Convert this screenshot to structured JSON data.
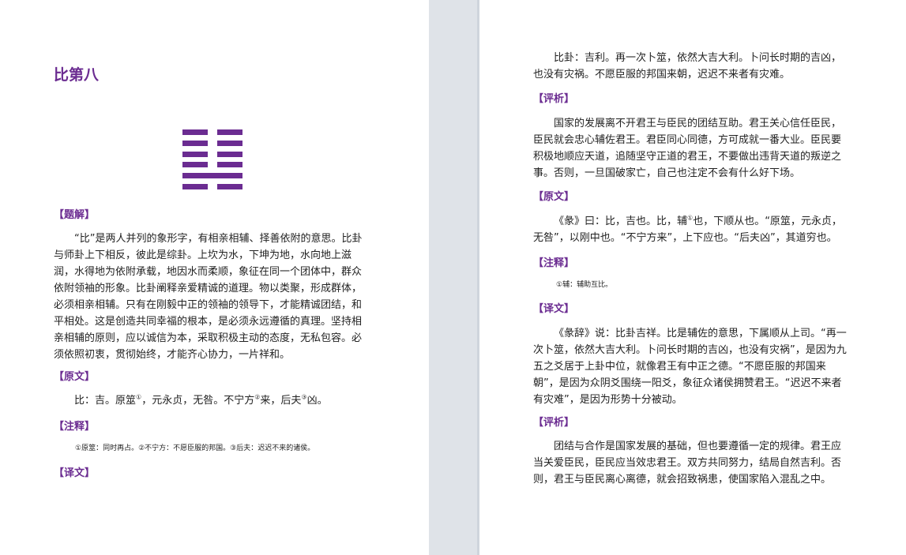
{
  "left_page": {
    "title": "比第八",
    "hexagram_lines": [
      "broken",
      "broken",
      "broken",
      "broken",
      "solid",
      "broken"
    ],
    "sections": {
      "tijie_heading": "【题解】",
      "tijie_lines": [
        "“比”是两人并列的象形字，有相亲相辅、择善依附的意思。比卦",
        "与师卦上下相反，彼此是综卦。上坎为水，下坤为地，水向地上滋",
        "润，水得地为依附承载，地因水而柔顺，象征在同一个团体中，群众",
        "依附领袖的形象。比卦阐释亲爱精诚的道理。物以类聚，形成群体，",
        "必须相亲相辅。只有在刚毅中正的领袖的领导下，才能精诚团结，和",
        "平相处。这是创造共同幸福的根本，是必须永远遵循的真理。坚持相",
        "亲相辅的原则，应以诚信为本，采取积极主动的态度，无私包容。必",
        "须依照初衷，贯彻始终，才能齐心协力，一片祥和。"
      ],
      "yuanwen_heading": "【原文】",
      "yuanwen_parts": [
        "比：吉。原筮",
        "①",
        "，元永贞，无咎。不宁方",
        "②",
        "来，后夫",
        "③",
        "凶。"
      ],
      "zhushi_heading": "【注释】",
      "zhushi_text": "①原筮：同时再占。②不宁方：不愿臣服的邦国。③后夫：迟迟不来的诸侯。",
      "yiwen_heading": "【译文】"
    }
  },
  "right_page": {
    "yiwen_lines": [
      "比卦：吉利。再一次卜筮，依然大吉大利。卜问长时期的吉凶，",
      "也没有灾祸。不愿臣服的邦国来朝，迟迟不来者有灾难。"
    ],
    "pingxi1_heading": "【评析】",
    "pingxi1_lines": [
      "国家的发展离不开君王与臣民的团结互助。君王关心信任臣民，",
      "臣民就会忠心辅佐君王。君臣同心同德，方可成就一番大业。臣民要",
      "积极地顺应天道，追随坚守正道的君王，不要做出违背天道的叛逆之",
      "事。否则，一旦国破家亡，自己也注定不会有什么好下场。"
    ],
    "yuanwen_heading": "【原文】",
    "yuanwen_line1_parts": [
      "《彖》曰：比，吉也。比，辅",
      "①",
      "也，下顺从也。“原筮，元永贞，"
    ],
    "yuanwen_line2": "无咎”，以刚中也。“不宁方来”，上下应也。“后夫凶”，其道穷也。",
    "zhushi_heading": "【注释】",
    "zhushi_text": "①辅：辅助互比。",
    "yiwen_heading": "【译文】",
    "yiwen2_lines": [
      "《彖辞》说：比卦吉祥。比是辅佐的意思，下属顺从上司。“再一",
      "次卜筮，依然大吉大利。卜问长时期的吉凶，也没有灾祸”，是因为九",
      "五之爻居于上卦中位，就像君王有中正之德。“不愿臣服的邦国来",
      "朝”，是因为众阴爻围绕一阳爻，象征众诸侯拥赞君王。“迟迟不来者",
      "有灾难”，是因为形势十分被动。"
    ],
    "pingxi2_heading": "【评析】",
    "pingxi2_lines": [
      "团结与合作是国家发展的基础，但也要遵循一定的规律。君王应",
      "当关爱臣民，臣民应当效忠君王。双方共同努力，结局自然吉利。否",
      "则，君王与臣民离心离德，就会招致祸患，使国家陷入混乱之中。"
    ]
  },
  "colors": {
    "accent": "#6b2c91",
    "text": "#222222",
    "background": "#dfe3e8"
  }
}
